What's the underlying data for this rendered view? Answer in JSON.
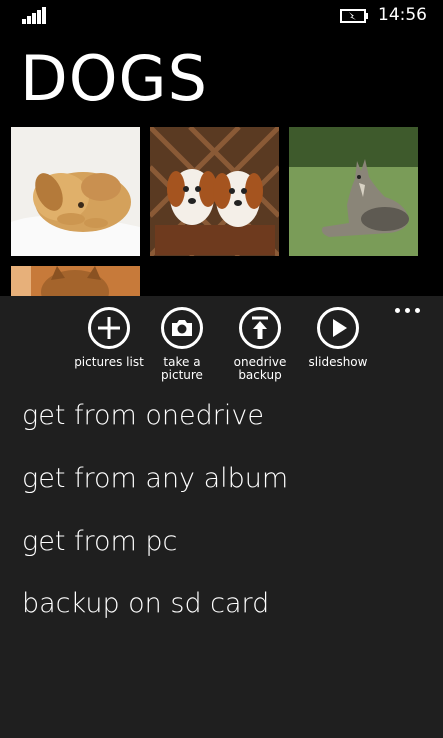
{
  "status_bar": {
    "time": "14:56",
    "signal_icon": "signal-strength-icon",
    "battery_icon": "battery-charging-icon"
  },
  "app": {
    "title": "DOGS"
  },
  "gallery": {
    "photos": [
      {
        "subject": "sleeping-puppy-photo"
      },
      {
        "subject": "two-puppies-photo"
      },
      {
        "subject": "wolf-dog-on-grass-photo"
      },
      {
        "subject": "dog-photo-partial"
      }
    ]
  },
  "app_bar": {
    "more_icon": "ellipsis-icon",
    "buttons": [
      {
        "label": "pictures list",
        "icon": "add-icon"
      },
      {
        "label": "take a\npicture",
        "icon": "camera-icon"
      },
      {
        "label": "onedrive\nbackup",
        "icon": "upload-icon"
      },
      {
        "label": "slideshow",
        "icon": "play-icon"
      }
    ],
    "menu_items": [
      "get from onedrive",
      "get from any album",
      "get from pc",
      "backup on sd card"
    ]
  }
}
